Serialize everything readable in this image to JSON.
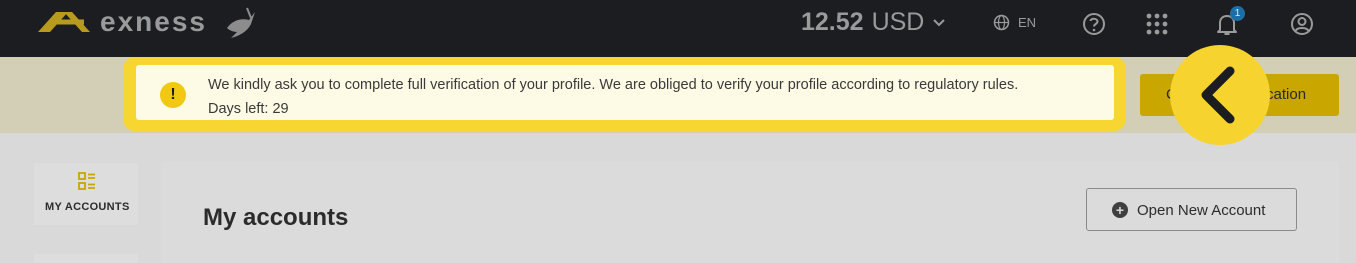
{
  "header": {
    "brand": "exness",
    "balance_amount": "12.52",
    "balance_currency": "USD",
    "language": "EN",
    "notification_count": "1",
    "icons": [
      "exness-logo-icon",
      "dove-icon",
      "chevron-down-icon",
      "globe-icon",
      "help-icon",
      "apps-grid-icon",
      "bell-icon",
      "profile-icon"
    ]
  },
  "verification": {
    "message": "We kindly ask you to complete full verification of your profile. We are obliged to verify your profile according to regulatory rules.",
    "days_left": "Days left: 29",
    "button_label": "Complete verification",
    "icons": [
      "warning-icon",
      "arrow-left-icon"
    ]
  },
  "sidebar": {
    "items": [
      {
        "label": "MY ACCOUNTS",
        "icon": "accounts-icon"
      }
    ]
  },
  "main": {
    "title": "My accounts",
    "open_account_label": "Open New Account",
    "icons": [
      "plus-circle-icon"
    ]
  },
  "colors": {
    "topbar": "#1b1d21",
    "accent_yellow": "#f7d631",
    "notice_bg": "#fdfbe5",
    "badge_blue": "#1d6ea6"
  }
}
